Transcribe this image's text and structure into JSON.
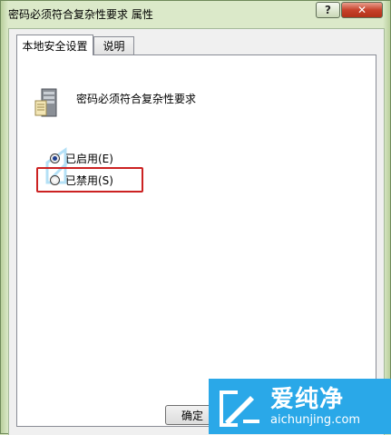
{
  "window": {
    "title": "密码必须符合复杂性要求 属性",
    "help_label": "?",
    "close_label": "✕"
  },
  "tabs": [
    {
      "label": "本地安全设置",
      "active": true
    },
    {
      "label": "说明",
      "active": false
    }
  ],
  "policy": {
    "icon": "server-policy-icon",
    "title": "密码必须符合复杂性要求"
  },
  "options": [
    {
      "label": "已启用(E)",
      "checked": true
    },
    {
      "label": "已禁用(S)",
      "checked": false
    }
  ],
  "buttons": {
    "ok_label": "确定"
  },
  "watermark": {
    "name": "爱纯净",
    "url": "aichunjing.com"
  },
  "colors": {
    "highlight": "#cc2222",
    "watermark_bg": "#2aa8e8",
    "close_button": "#c7412b"
  }
}
